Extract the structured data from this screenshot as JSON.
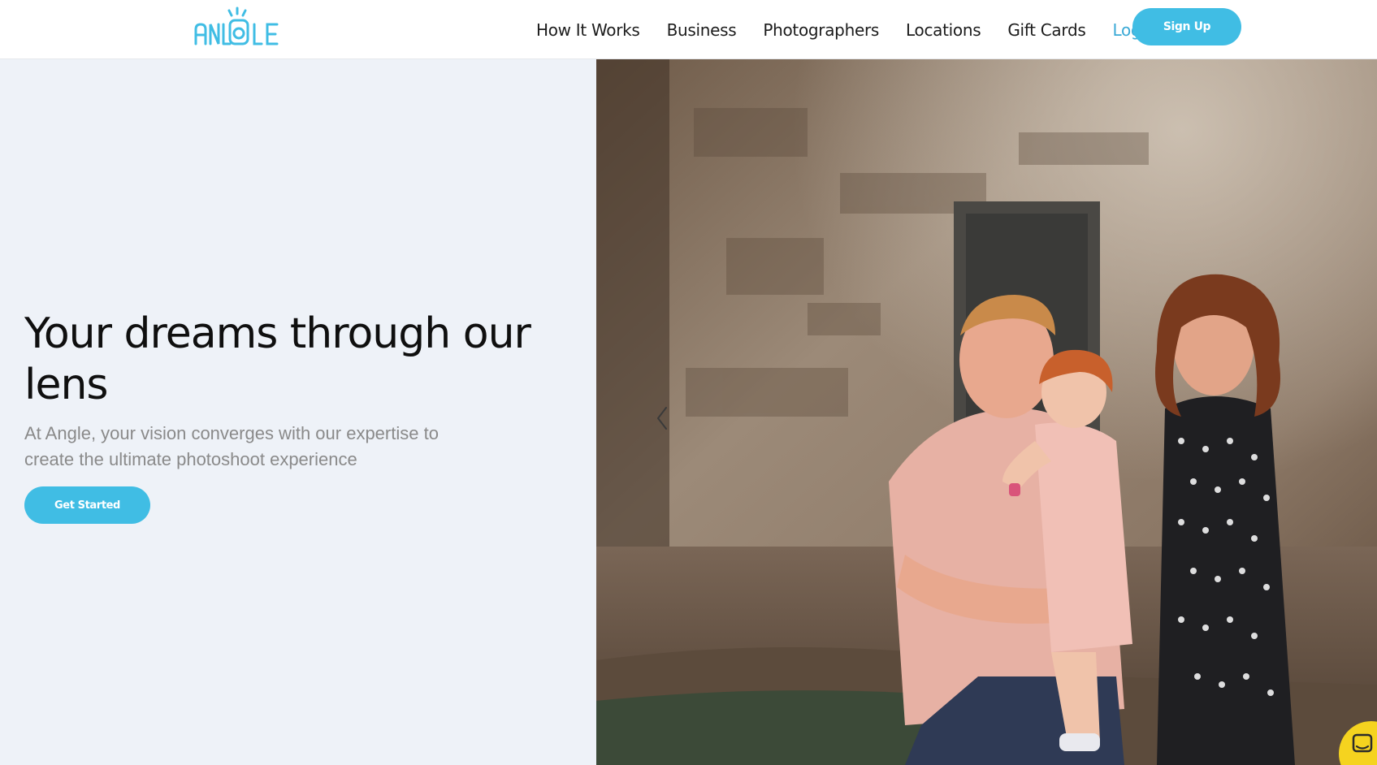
{
  "brand": {
    "logo_text": "ANGLE",
    "accent_color": "#40bde4"
  },
  "nav": {
    "items": [
      {
        "label": "How It Works"
      },
      {
        "label": "Business"
      },
      {
        "label": "Photographers"
      },
      {
        "label": "Locations"
      },
      {
        "label": "Gift Cards"
      }
    ],
    "login_label": "Log In",
    "signup_label": "Sign Up"
  },
  "hero": {
    "title": "Your dreams through our lens",
    "subtitle": "At Angle, your vision converges with our expertise to create the ultimate photoshoot experience",
    "cta_label": "Get Started"
  },
  "photo": {
    "carousel_prev_icon": "chevron-left-icon"
  },
  "chat": {
    "icon": "chat-icon"
  }
}
